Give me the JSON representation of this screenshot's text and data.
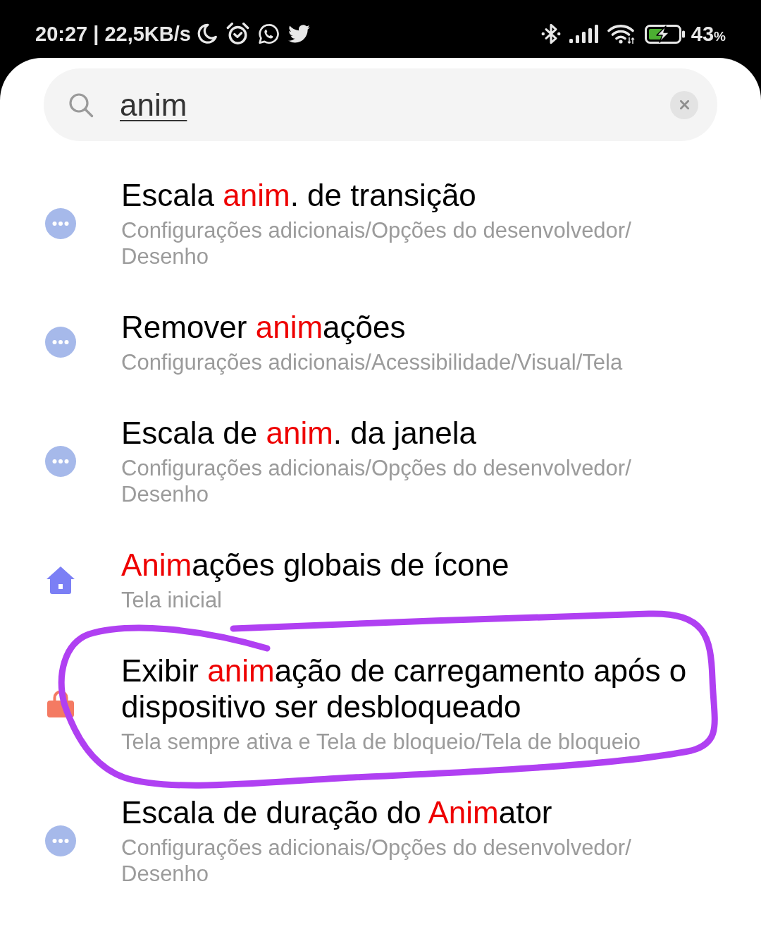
{
  "status_bar": {
    "time_speed": "20:27 | 22,5KB/s",
    "battery": {
      "charging": true,
      "percent": "43",
      "unit": "%"
    }
  },
  "search": {
    "value": "anim"
  },
  "results": [
    {
      "kind": "dots",
      "title": [
        {
          "text": "Escala ",
          "match": false
        },
        {
          "text": "anim",
          "match": true
        },
        {
          "text": ". de transição",
          "match": false
        }
      ],
      "path": "Configurações adicionais/Opções do desenvolvedor/Desenho",
      "circled": false
    },
    {
      "kind": "dots",
      "title": [
        {
          "text": "Remover ",
          "match": false
        },
        {
          "text": "anim",
          "match": true
        },
        {
          "text": "ações",
          "match": false
        }
      ],
      "path": "Configurações adicionais/Acessibilidade/Visual/Tela",
      "circled": false
    },
    {
      "kind": "dots",
      "title": [
        {
          "text": "Escala de ",
          "match": false
        },
        {
          "text": "anim",
          "match": true
        },
        {
          "text": ". da janela",
          "match": false
        }
      ],
      "path": "Configurações adicionais/Opções do desenvolvedor/Desenho",
      "circled": false
    },
    {
      "kind": "home",
      "title": [
        {
          "text": "Anim",
          "match": true
        },
        {
          "text": "ações globais de ícone",
          "match": false
        }
      ],
      "path": "Tela inicial",
      "circled": false
    },
    {
      "kind": "lock",
      "title": [
        {
          "text": "Exibir ",
          "match": false
        },
        {
          "text": "anim",
          "match": true
        },
        {
          "text": "ação de carregamento após o dispositivo ser desbloqueado",
          "match": false
        }
      ],
      "path": "Tela sempre ativa e Tela de bloqueio/Tela de bloqueio",
      "circled": true
    },
    {
      "kind": "dots",
      "title": [
        {
          "text": "Escala de duração do ",
          "match": false
        },
        {
          "text": "Anim",
          "match": true
        },
        {
          "text": "ator",
          "match": false
        }
      ],
      "path": "Configurações adicionais/Opções do desenvolvedor/Desenho",
      "circled": false
    }
  ]
}
